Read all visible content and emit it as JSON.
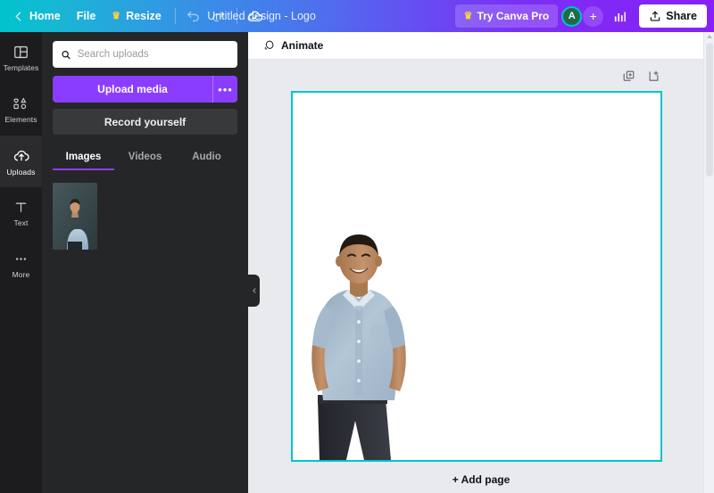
{
  "topbar": {
    "home_label": "Home",
    "file_label": "File",
    "resize_label": "Resize",
    "crown_icon": "crown-icon",
    "undo_icon": "undo-icon",
    "redo_icon": "redo-icon",
    "saved_icon": "cloud-saved-icon",
    "design_title": "Untitled design - Logo",
    "pro_label": "Try Canva Pro",
    "avatar_initial": "A",
    "add_member_label": "+",
    "analytics_icon": "bar-chart-icon",
    "share_label": "Share",
    "share_icon": "upload-icon",
    "gradient_start": "#00c4cc",
    "gradient_end": "#8622f6"
  },
  "rail": {
    "items": [
      {
        "label": "Templates",
        "icon": "templates-icon",
        "active": false
      },
      {
        "label": "Elements",
        "icon": "elements-icon",
        "active": false
      },
      {
        "label": "Uploads",
        "icon": "cloud-upload-icon",
        "active": true
      },
      {
        "label": "Text",
        "icon": "text-icon",
        "active": false
      },
      {
        "label": "More",
        "icon": "more-dots-icon",
        "active": false
      }
    ]
  },
  "panel": {
    "search_placeholder": "Search uploads",
    "search_value": "",
    "search_icon": "search-icon",
    "upload_label": "Upload media",
    "upload_more_label": "•••",
    "record_label": "Record yourself",
    "accent_color": "#8b3dff",
    "tabs": [
      {
        "label": "Images",
        "active": true
      },
      {
        "label": "Videos",
        "active": false
      },
      {
        "label": "Audio",
        "active": false
      }
    ],
    "thumbnails": [
      {
        "name": "portrait-upload-thumbnail"
      }
    ],
    "collapse_icon": "chevron-left-icon"
  },
  "editor": {
    "animate_label": "Animate",
    "animate_icon": "animate-icon",
    "duplicate_icon": "duplicate-page-icon",
    "add_page_icon": "add-page-icon",
    "comment_icon": "comment-add-icon",
    "add_page_label": "+ Add page",
    "canvas_background": "#ffffff",
    "selection_color": "#00c4cc",
    "workspace_background": "#e9eaee"
  }
}
